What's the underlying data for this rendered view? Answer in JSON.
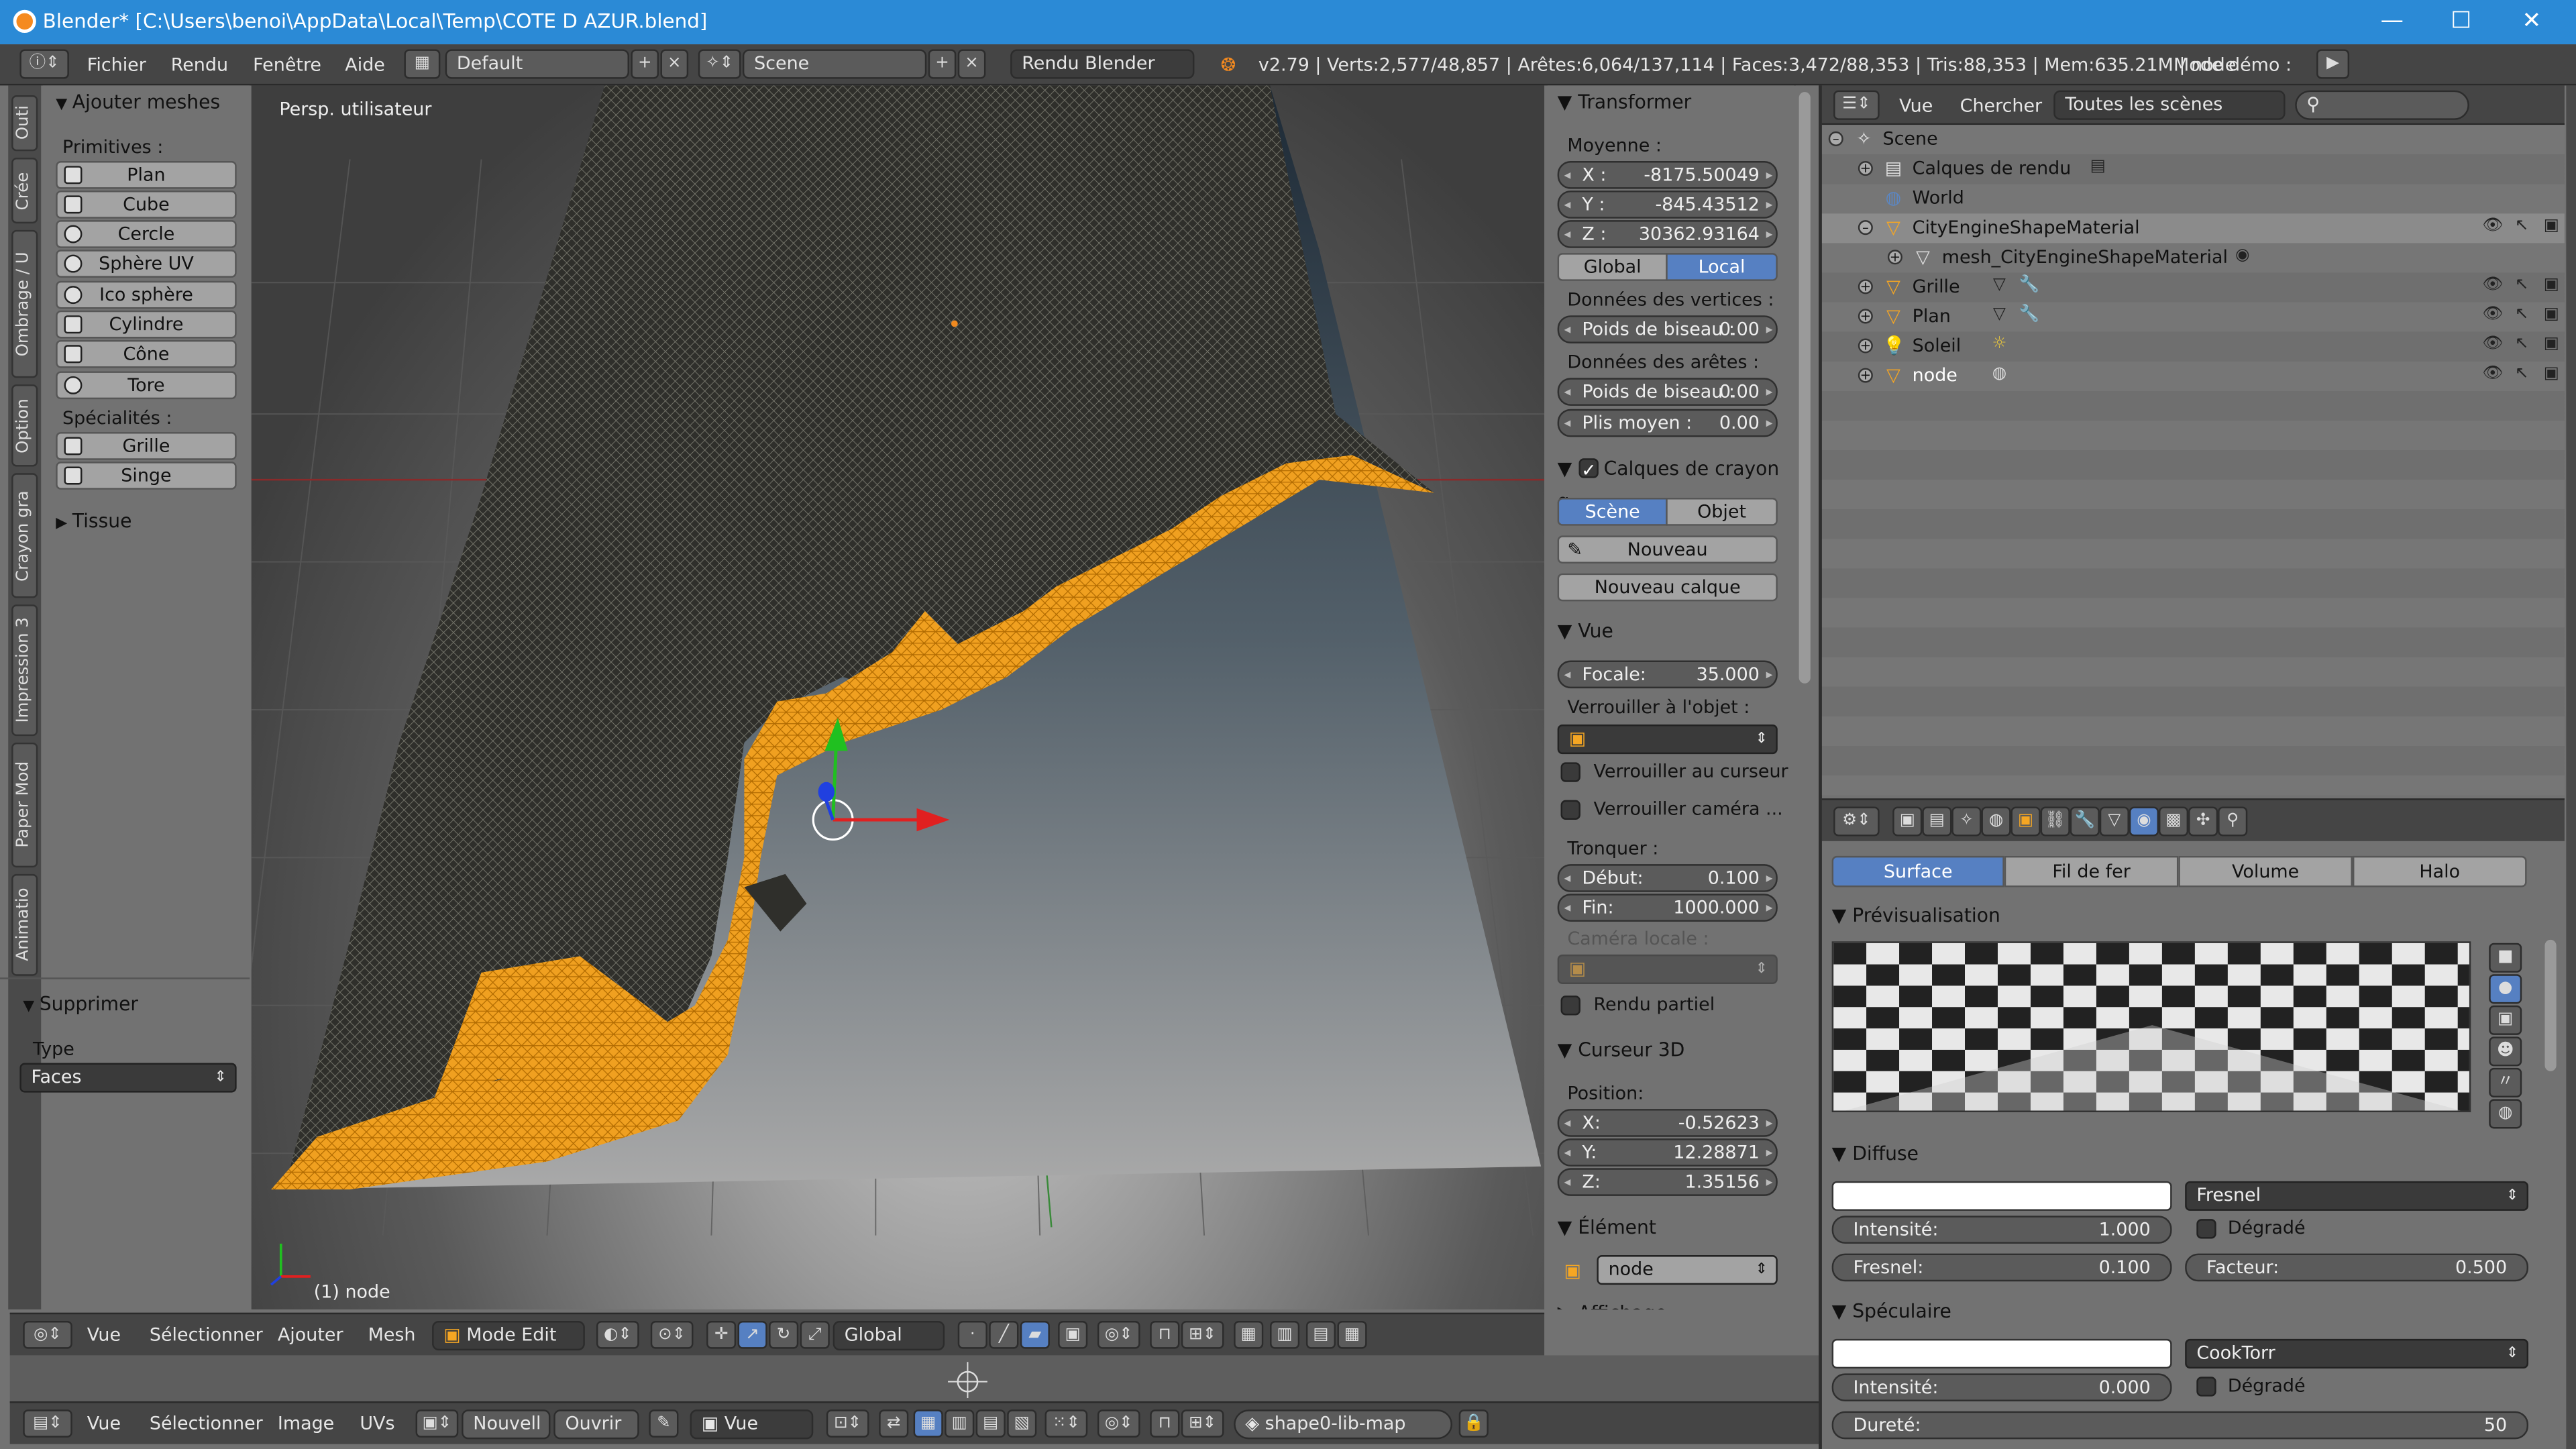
{
  "window": {
    "title": "Blender* [C:\\Users\\benoi\\AppData\\Local\\Temp\\COTE D AZUR.blend]",
    "minimize": "—",
    "maximize": "☐",
    "close": "✕"
  },
  "menubar": {
    "menus": [
      "Fichier",
      "Rendu",
      "Fenêtre",
      "Aide"
    ],
    "layout": "Default",
    "scene": "Scene",
    "engine": "Rendu Blender",
    "stats": "v2.79 | Verts:2,577/48,857 | Arêtes:6,064/137,114 | Faces:3,472/88,353 | Tris:88,353 | Mem:635.21M | node",
    "demo_mode": "Mode démo :"
  },
  "side_tabs": [
    "Outi",
    "Crée",
    "Ombrage / U",
    "Option",
    "Crayon gra",
    "Impression 3",
    "Paper Mod",
    "Animatio"
  ],
  "toolshelf": {
    "add_meshes_header": "Ajouter meshes",
    "primitives_label": "Primitives :",
    "primitives": [
      "Plan",
      "Cube",
      "Cercle",
      "Sphère UV",
      "Ico sphère",
      "Cylindre",
      "Cône",
      "Tore"
    ],
    "specials_label": "Spécialités :",
    "specials": [
      "Grille",
      "Singe"
    ],
    "tissue_header": "Tissue",
    "delete_header": "Supprimer",
    "type_label": "Type",
    "type_value": "Faces"
  },
  "viewport": {
    "view_name": "Persp. utilisateur",
    "object_name": "(1) node"
  },
  "npanel": {
    "transform_header": "Transformer",
    "median_label": "Moyenne :",
    "x": "-8175.50049",
    "y": "-845.43512",
    "z": "30362.93164",
    "global": "Global",
    "local": "Local",
    "vertex_data_label": "Données des vertices :",
    "bevel_weight_label": "Poids de biseau :",
    "bevel_weight_v": "0.00",
    "edge_data_label": "Données des arêtes :",
    "bevel_weight_e": "0.00",
    "mean_crease_label": "Plis moyen :",
    "mean_crease": "0.00",
    "gp_layers_header": "Calques de crayon g",
    "scene_btn": "Scène",
    "object_btn": "Objet",
    "new_btn": "Nouveau",
    "new_layer_btn": "Nouveau calque",
    "view_header": "Vue",
    "focal_label": "Focale:",
    "focal": "35.000",
    "lock_object_label": "Verrouiller à l'objet :",
    "lock_cursor": "Verrouiller au curseur",
    "lock_camera": "Verrouiller caméra ...",
    "clip_label": "Tronquer :",
    "clip_start_label": "Début:",
    "clip_start": "0.100",
    "clip_end_label": "Fin:",
    "clip_end": "1000.000",
    "local_camera_label": "Caméra locale :",
    "render_border": "Rendu partiel",
    "cursor_header": "Curseur 3D",
    "position_label": "Position:",
    "cx": "-0.52623",
    "cy": "12.28871",
    "cz": "1.35156",
    "item_header": "Élément",
    "item_name": "node",
    "display_header": "Affichage"
  },
  "outliner": {
    "view": "Vue",
    "search": "Chercher",
    "filter": "Toutes les scènes",
    "rows": [
      {
        "label": "Scene",
        "indent": 0
      },
      {
        "label": "Calques de rendu",
        "indent": 1
      },
      {
        "label": "World",
        "indent": 1
      },
      {
        "label": "CityEngineShapeMaterial",
        "indent": 1
      },
      {
        "label": "mesh_CityEngineShapeMaterial",
        "indent": 2
      },
      {
        "label": "Grille",
        "indent": 1
      },
      {
        "label": "Plan",
        "indent": 1
      },
      {
        "label": "Soleil",
        "indent": 1
      },
      {
        "label": "node",
        "indent": 1
      }
    ]
  },
  "properties": {
    "tabs": [
      "Surface",
      "Fil de fer",
      "Volume",
      "Halo"
    ],
    "preview_header": "Prévisualisation",
    "diffuse_header": "Diffuse",
    "diffuse_shader": "Fresnel",
    "intensity_label": "Intensité:",
    "diffuse_intensity": "1.000",
    "ramp_label": "Dégradé",
    "fresnel_label": "Fresnel:",
    "fresnel": "0.100",
    "factor_label": "Facteur:",
    "factor": "0.500",
    "specular_header": "Spéculaire",
    "specular_shader": "CookTorr",
    "specular_intensity": "0.000",
    "hardness_label": "Dureté:",
    "hardness": "50"
  },
  "header3d": {
    "menus": [
      "Vue",
      "Sélectionner",
      "Ajouter",
      "Mesh"
    ],
    "mode": "Mode Edit",
    "orientation": "Global"
  },
  "header_uv": {
    "menus": [
      "Vue",
      "Sélectionner",
      "Image",
      "UVs"
    ],
    "new": "Nouvell",
    "open": "Ouvrir",
    "view": "Vue",
    "image": "shape0-lib-map"
  },
  "colors": {
    "titlebar": "#2b8ad6",
    "selection_orange": "#f5a623",
    "active_blue": "#5680c2"
  }
}
